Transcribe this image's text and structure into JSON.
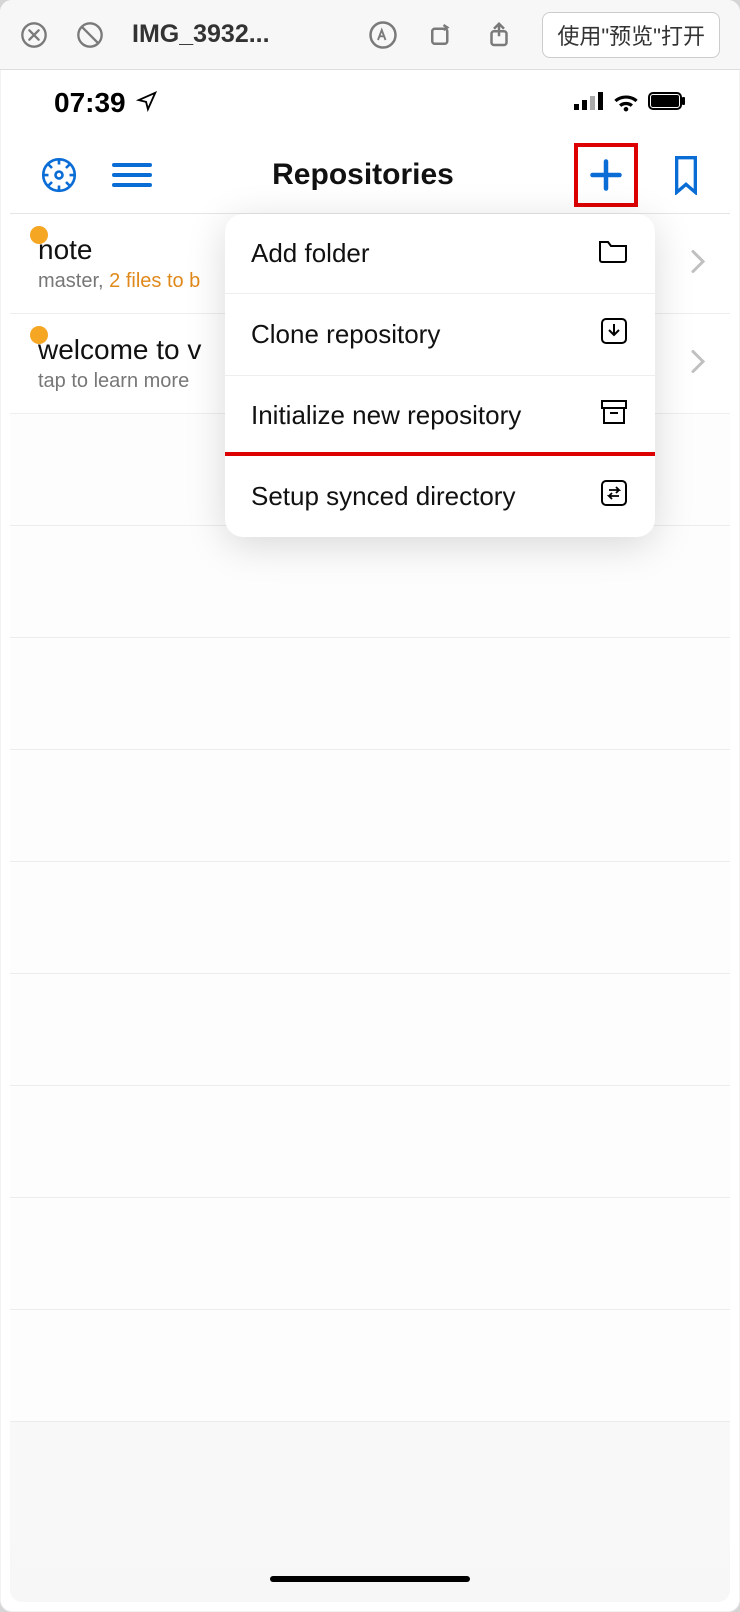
{
  "mac_toolbar": {
    "filename": "IMG_3932...",
    "open_button": "使用\"预览\"打开"
  },
  "status_bar": {
    "time": "07:39"
  },
  "app_header": {
    "title": "Repositories"
  },
  "repos": [
    {
      "name": "note",
      "sub_prefix": "master, ",
      "sub_highlight": "2 files to b"
    },
    {
      "name": "welcome to v",
      "sub": "tap to learn more"
    }
  ],
  "popover": {
    "items": [
      {
        "label": "Add folder",
        "icon": "folder"
      },
      {
        "label": "Clone repository",
        "icon": "download"
      },
      {
        "label": "Initialize new repository",
        "icon": "archive"
      },
      {
        "label": "Setup synced directory",
        "icon": "sync"
      }
    ]
  }
}
